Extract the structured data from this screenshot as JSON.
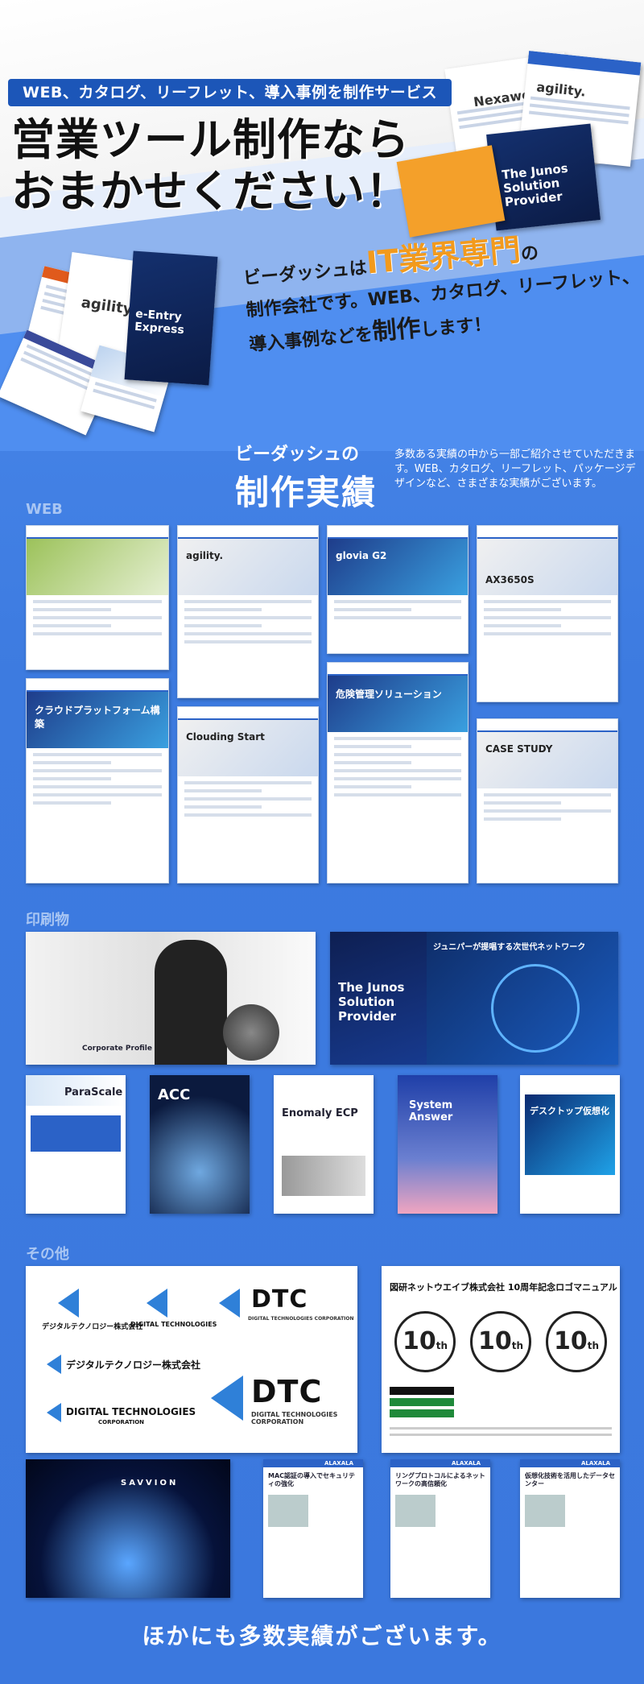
{
  "hero": {
    "badge": "WEB、カタログ、リーフレット、導入事例を制作サービス",
    "title_line1": "営業ツール制作なら",
    "title_line2": "おまかせください！",
    "tagline_part1": "ビーダッシュは",
    "tagline_highlight": "IT業界専門",
    "tagline_part2": "の",
    "tagline_line2": "制作会社です。WEB、カタログ、リーフレット、",
    "tagline_line3a": "導入事例などを",
    "tagline_line3b": "制作",
    "tagline_line3c": "します！",
    "collage_labels": [
      "Nexaweb",
      "agility.",
      "The Junos Solution Provider",
      "e-Entry Express",
      "agility."
    ]
  },
  "works": {
    "heading_small": "ビーダッシュの",
    "heading_large": "制作実績",
    "description": "多数ある実績の中から一部ご紹介させていただきます。WEB、カタログ、リーフレット、パッケージデザインなど、さまざまな実績がございます。"
  },
  "sections": {
    "web_label": "WEB",
    "print_label": "印刷物",
    "other_label": "その他"
  },
  "web_shots": [
    {
      "title": "",
      "theme": "g"
    },
    {
      "title": "agility.",
      "theme": "w"
    },
    {
      "title": "glovia G2",
      "theme": "b"
    },
    {
      "title": "AX3650S",
      "theme": "w"
    },
    {
      "title": "クラウドプラットフォーム構築",
      "theme": "b"
    },
    {
      "title": "Clouding Start",
      "theme": "w"
    },
    {
      "title": "危険管理ソリューション",
      "theme": "b"
    },
    {
      "title": "CASE STUDY",
      "theme": "w"
    }
  ],
  "print_items": {
    "large1": "Corporate Profile",
    "large2_left": "The Junos Solution Provider",
    "large2_right": "ジュニパーが提唱する次世代ネットワーク",
    "small": [
      "ParaScale",
      "ACC",
      "Enomaly ECP",
      "System Answer",
      "デスクトップ仮想化"
    ]
  },
  "other": {
    "logos": {
      "jp_name": "デジタルテクノロジー株式会社",
      "en_name": "DIGITAL TECHNOLOGIES",
      "en_sub": "CORPORATION",
      "dtc": "DTC",
      "dtc_sub": "DIGITAL TECHNOLOGIES CORPORATION"
    },
    "manual_title": "図研ネットウエイブ株式会社 10周年記念ロゴマニュアル",
    "tenth_mark": "10",
    "tenth_suffix": "th",
    "savvion": "SAVVION",
    "case_titles": [
      "MAC認証の導入でセキュリティの強化",
      "リングプロトコルによるネットワークの高信頼化",
      "仮想化技術を活用したデータセンター"
    ],
    "case_brand": "ALAXALA"
  },
  "footer": "ほかにも多数実績がございます。",
  "colors": {
    "accent": "#f29a1d",
    "brand_blue": "#2b62c7",
    "background": "#3f7fe0"
  }
}
